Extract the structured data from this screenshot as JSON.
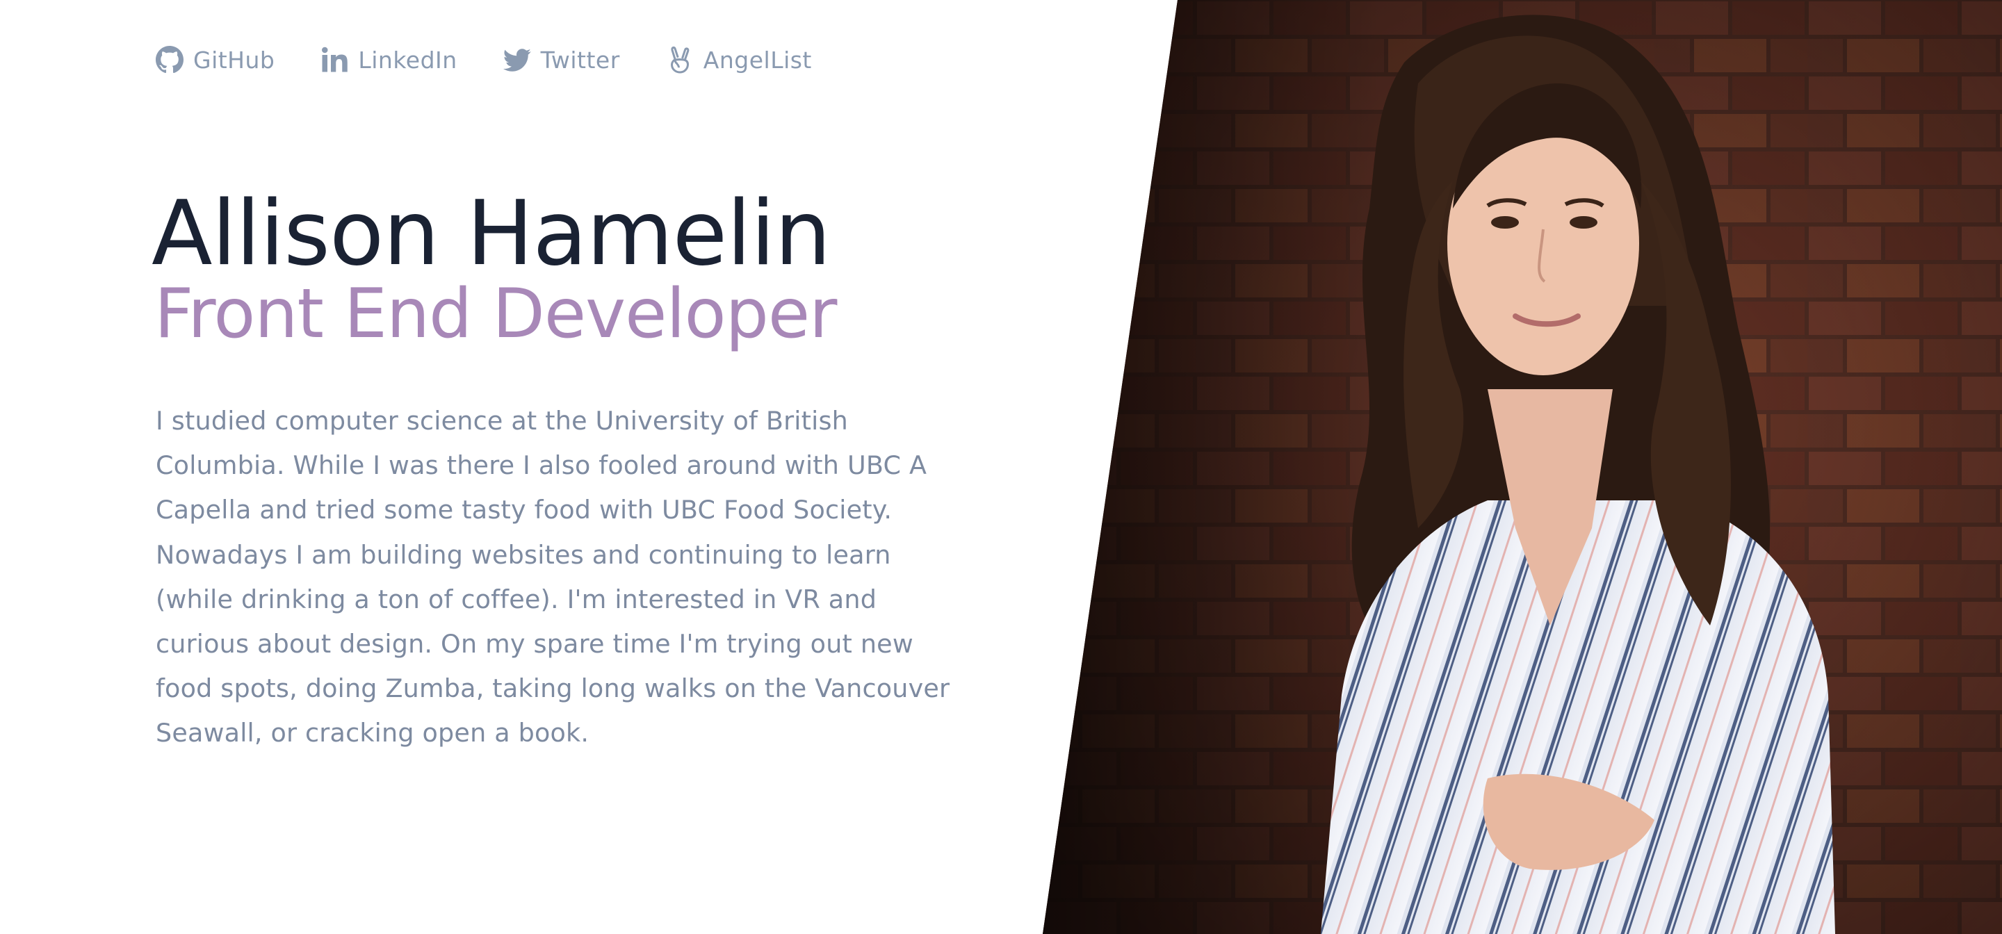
{
  "social_links": [
    {
      "label": "GitHub",
      "icon": "github-icon"
    },
    {
      "label": "LinkedIn",
      "icon": "linkedin-icon"
    },
    {
      "label": "Twitter",
      "icon": "twitter-icon"
    },
    {
      "label": "AngelList",
      "icon": "angellist-icon"
    }
  ],
  "hero": {
    "name": "Allison Hamelin",
    "role": "Front End Developer",
    "bio": "I studied computer science at the University of British Columbia. While I was there I also fooled around with UBC A Capella and tried some tasty food with UBC Food Society. Nowadays I am building websites and continuing to learn (while drinking a ton of coffee). I'm interested in VR and curious about design. On my spare time I'm trying out new food spots, doing Zumba, taking long walks on the Vancouver Seawall, or cracking open a book."
  },
  "colors": {
    "name": "#1a2233",
    "role": "#a888b8",
    "bio": "#7d8aa0",
    "social": "#8a9ab0",
    "background": "#ffffff"
  }
}
